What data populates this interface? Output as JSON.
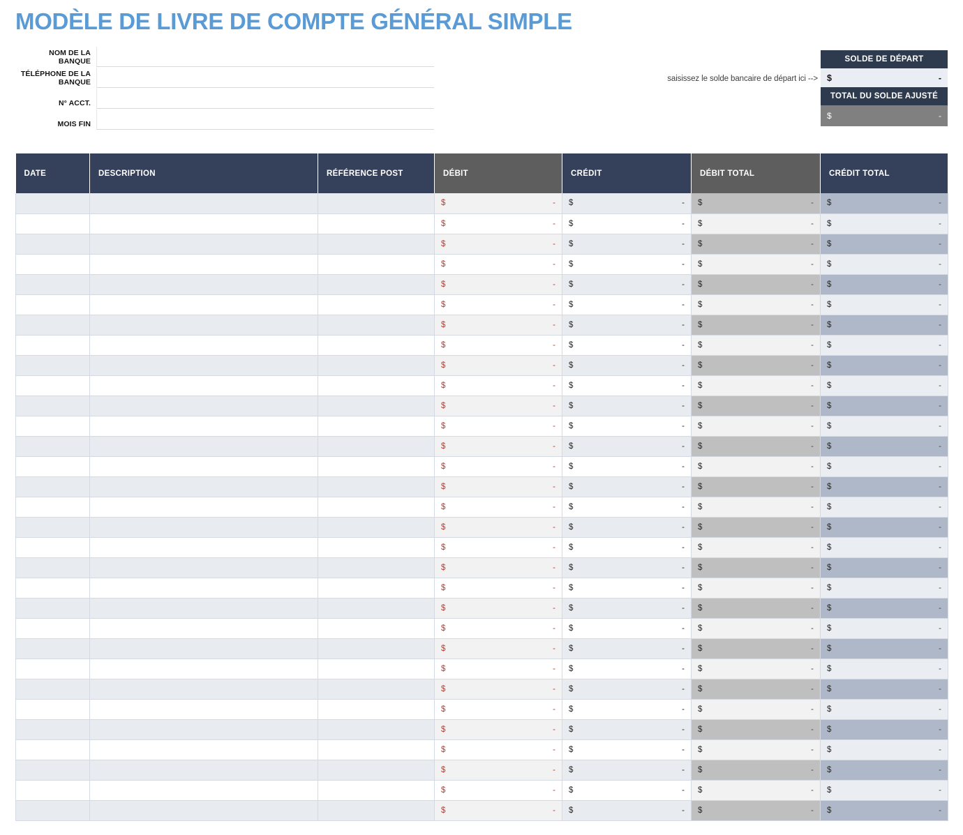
{
  "title": "MODÈLE DE LIVRE DE COMPTE GÉNÉRAL SIMPLE",
  "form": {
    "fields": [
      {
        "label": "NOM DE LA BANQUE",
        "value": "",
        "placeholder": ""
      },
      {
        "label": "TÉLÉPHONE DE LA BANQUE",
        "value": "",
        "placeholder": ""
      },
      {
        "label": "N° ACCT.",
        "value": "",
        "placeholder": ""
      },
      {
        "label": "MOIS FIN",
        "value": "",
        "placeholder": ""
      }
    ]
  },
  "balance_panel": {
    "hint": "saisissez le solde bancaire de départ ici -->",
    "starting_balance_label": "SOLDE DE DÉPART",
    "starting_balance_currency": "$",
    "starting_balance_value": "-",
    "adjusted_total_label": "TOTAL DU SOLDE AJUSTÉ",
    "adjusted_total_currency": "$",
    "adjusted_total_value": "-"
  },
  "ledger": {
    "columns": [
      {
        "key": "date",
        "label": "DATE",
        "header_color": "#35415a"
      },
      {
        "key": "desc",
        "label": "DESCRIPTION",
        "header_color": "#35415a"
      },
      {
        "key": "ref",
        "label": "RÉFÉRENCE POST",
        "header_color": "#35415a"
      },
      {
        "key": "debit",
        "label": "DÉBIT",
        "header_color": "#5e5e5e"
      },
      {
        "key": "credit",
        "label": "CRÉDIT",
        "header_color": "#35415a"
      },
      {
        "key": "dtotal",
        "label": "DÉBIT TOTAL",
        "header_color": "#5e5e5e"
      },
      {
        "key": "ctotal",
        "label": "CRÉDIT TOTAL",
        "header_color": "#35415a"
      }
    ],
    "row_count": 31,
    "currency_symbol": "$",
    "empty_value": "-",
    "rows": [
      {
        "date": "",
        "desc": "",
        "ref": "",
        "debit": "-",
        "credit": "-",
        "dtotal": "-",
        "ctotal": "-"
      },
      {
        "date": "",
        "desc": "",
        "ref": "",
        "debit": "-",
        "credit": "-",
        "dtotal": "-",
        "ctotal": "-"
      },
      {
        "date": "",
        "desc": "",
        "ref": "",
        "debit": "-",
        "credit": "-",
        "dtotal": "-",
        "ctotal": "-"
      },
      {
        "date": "",
        "desc": "",
        "ref": "",
        "debit": "-",
        "credit": "-",
        "dtotal": "-",
        "ctotal": "-"
      },
      {
        "date": "",
        "desc": "",
        "ref": "",
        "debit": "-",
        "credit": "-",
        "dtotal": "-",
        "ctotal": "-"
      },
      {
        "date": "",
        "desc": "",
        "ref": "",
        "debit": "-",
        "credit": "-",
        "dtotal": "-",
        "ctotal": "-"
      },
      {
        "date": "",
        "desc": "",
        "ref": "",
        "debit": "-",
        "credit": "-",
        "dtotal": "-",
        "ctotal": "-"
      },
      {
        "date": "",
        "desc": "",
        "ref": "",
        "debit": "-",
        "credit": "-",
        "dtotal": "-",
        "ctotal": "-"
      },
      {
        "date": "",
        "desc": "",
        "ref": "",
        "debit": "-",
        "credit": "-",
        "dtotal": "-",
        "ctotal": "-"
      },
      {
        "date": "",
        "desc": "",
        "ref": "",
        "debit": "-",
        "credit": "-",
        "dtotal": "-",
        "ctotal": "-"
      },
      {
        "date": "",
        "desc": "",
        "ref": "",
        "debit": "-",
        "credit": "-",
        "dtotal": "-",
        "ctotal": "-"
      },
      {
        "date": "",
        "desc": "",
        "ref": "",
        "debit": "-",
        "credit": "-",
        "dtotal": "-",
        "ctotal": "-"
      },
      {
        "date": "",
        "desc": "",
        "ref": "",
        "debit": "-",
        "credit": "-",
        "dtotal": "-",
        "ctotal": "-"
      },
      {
        "date": "",
        "desc": "",
        "ref": "",
        "debit": "-",
        "credit": "-",
        "dtotal": "-",
        "ctotal": "-"
      },
      {
        "date": "",
        "desc": "",
        "ref": "",
        "debit": "-",
        "credit": "-",
        "dtotal": "-",
        "ctotal": "-"
      },
      {
        "date": "",
        "desc": "",
        "ref": "",
        "debit": "-",
        "credit": "-",
        "dtotal": "-",
        "ctotal": "-"
      },
      {
        "date": "",
        "desc": "",
        "ref": "",
        "debit": "-",
        "credit": "-",
        "dtotal": "-",
        "ctotal": "-"
      },
      {
        "date": "",
        "desc": "",
        "ref": "",
        "debit": "-",
        "credit": "-",
        "dtotal": "-",
        "ctotal": "-"
      },
      {
        "date": "",
        "desc": "",
        "ref": "",
        "debit": "-",
        "credit": "-",
        "dtotal": "-",
        "ctotal": "-"
      },
      {
        "date": "",
        "desc": "",
        "ref": "",
        "debit": "-",
        "credit": "-",
        "dtotal": "-",
        "ctotal": "-"
      },
      {
        "date": "",
        "desc": "",
        "ref": "",
        "debit": "-",
        "credit": "-",
        "dtotal": "-",
        "ctotal": "-"
      },
      {
        "date": "",
        "desc": "",
        "ref": "",
        "debit": "-",
        "credit": "-",
        "dtotal": "-",
        "ctotal": "-"
      },
      {
        "date": "",
        "desc": "",
        "ref": "",
        "debit": "-",
        "credit": "-",
        "dtotal": "-",
        "ctotal": "-"
      },
      {
        "date": "",
        "desc": "",
        "ref": "",
        "debit": "-",
        "credit": "-",
        "dtotal": "-",
        "ctotal": "-"
      },
      {
        "date": "",
        "desc": "",
        "ref": "",
        "debit": "-",
        "credit": "-",
        "dtotal": "-",
        "ctotal": "-"
      },
      {
        "date": "",
        "desc": "",
        "ref": "",
        "debit": "-",
        "credit": "-",
        "dtotal": "-",
        "ctotal": "-"
      },
      {
        "date": "",
        "desc": "",
        "ref": "",
        "debit": "-",
        "credit": "-",
        "dtotal": "-",
        "ctotal": "-"
      },
      {
        "date": "",
        "desc": "",
        "ref": "",
        "debit": "-",
        "credit": "-",
        "dtotal": "-",
        "ctotal": "-"
      },
      {
        "date": "",
        "desc": "",
        "ref": "",
        "debit": "-",
        "credit": "-",
        "dtotal": "-",
        "ctotal": "-"
      },
      {
        "date": "",
        "desc": "",
        "ref": "",
        "debit": "-",
        "credit": "-",
        "dtotal": "-",
        "ctotal": "-"
      },
      {
        "date": "",
        "desc": "",
        "ref": "",
        "debit": "-",
        "credit": "-",
        "dtotal": "-",
        "ctotal": "-"
      }
    ]
  },
  "colors": {
    "title_blue": "#5b9bd5",
    "header_navy": "#35415a",
    "header_gray": "#5e5e5e",
    "panel_navy": "#2e3b4e",
    "adjusted_gray": "#808080",
    "debit_red": "#c0392b"
  }
}
